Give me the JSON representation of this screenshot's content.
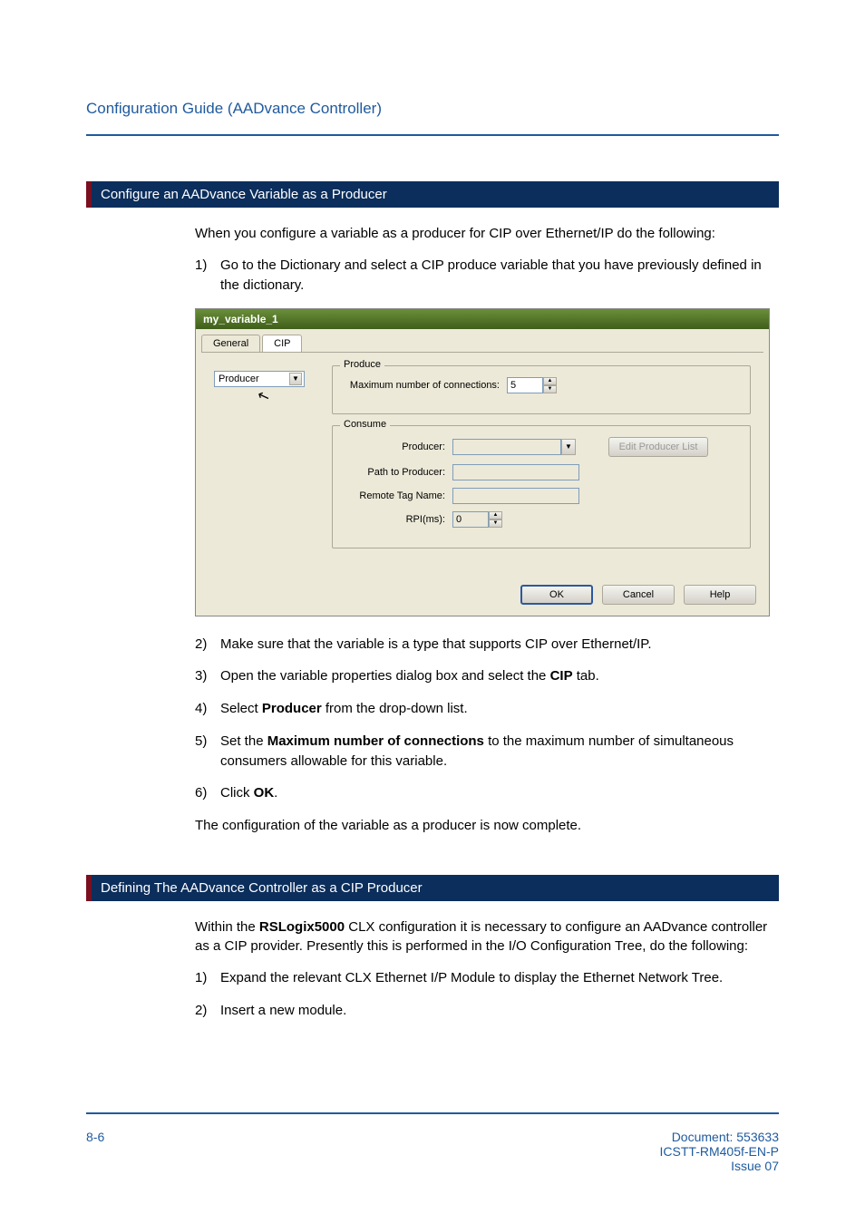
{
  "header": {
    "title": "Configuration Guide (AADvance Controller)"
  },
  "section1": {
    "title": "Configure an AADvance Variable as a Producer",
    "intro": "When you configure a variable as a producer for CIP over Ethernet/IP do the following:",
    "step1": "Go to the Dictionary and select a CIP produce variable that you have previously defined in the dictionary.",
    "step2": "Make sure that the variable is a type that supports CIP over Ethernet/IP.",
    "step3_pre": "Open the variable properties dialog box and select the ",
    "step3_bold": "CIP",
    "step3_post": " tab.",
    "step4_pre": "Select ",
    "step4_bold": "Producer",
    "step4_post": " from the drop-down list.",
    "step5_pre": "Set the ",
    "step5_bold": "Maximum number of connections",
    "step5_post": " to the maximum number of simultaneous consumers allowable for this variable.",
    "step6_pre": "Click ",
    "step6_bold": "OK",
    "step6_post": ".",
    "outro": "The configuration of the variable as a producer is now complete."
  },
  "dialog": {
    "title": "my_variable_1",
    "tabs": {
      "general": "General",
      "cip": "CIP"
    },
    "role": "Producer",
    "produce": {
      "legend": "Produce",
      "max_label": "Maximum number of connections:",
      "max_value": "5"
    },
    "consume": {
      "legend": "Consume",
      "producer_label": "Producer:",
      "path_label": "Path to Producer:",
      "tag_label": "Remote Tag Name:",
      "rpi_label": "RPI(ms):",
      "rpi_value": "0",
      "edit_btn": "Edit Producer List"
    },
    "buttons": {
      "ok": "OK",
      "cancel": "Cancel",
      "help": "Help"
    }
  },
  "section2": {
    "title": "Defining The AADvance Controller as a CIP Producer",
    "intro_pre": "Within the ",
    "intro_bold": "RSLogix5000",
    "intro_post": " CLX configuration it is necessary to configure an AADvance controller as a CIP provider. Presently this is performed in the I/O Configuration Tree, do the following:",
    "step1": "Expand the relevant CLX Ethernet I/P Module to display the Ethernet Network Tree.",
    "step2": "Insert a new module."
  },
  "footer": {
    "page": "8-6",
    "doc": "Document: 553633",
    "code": "ICSTT-RM405f-EN-P",
    "issue": "Issue 07"
  },
  "tri": {
    "up": "▲",
    "down": "▼"
  },
  "cursor": "↖"
}
